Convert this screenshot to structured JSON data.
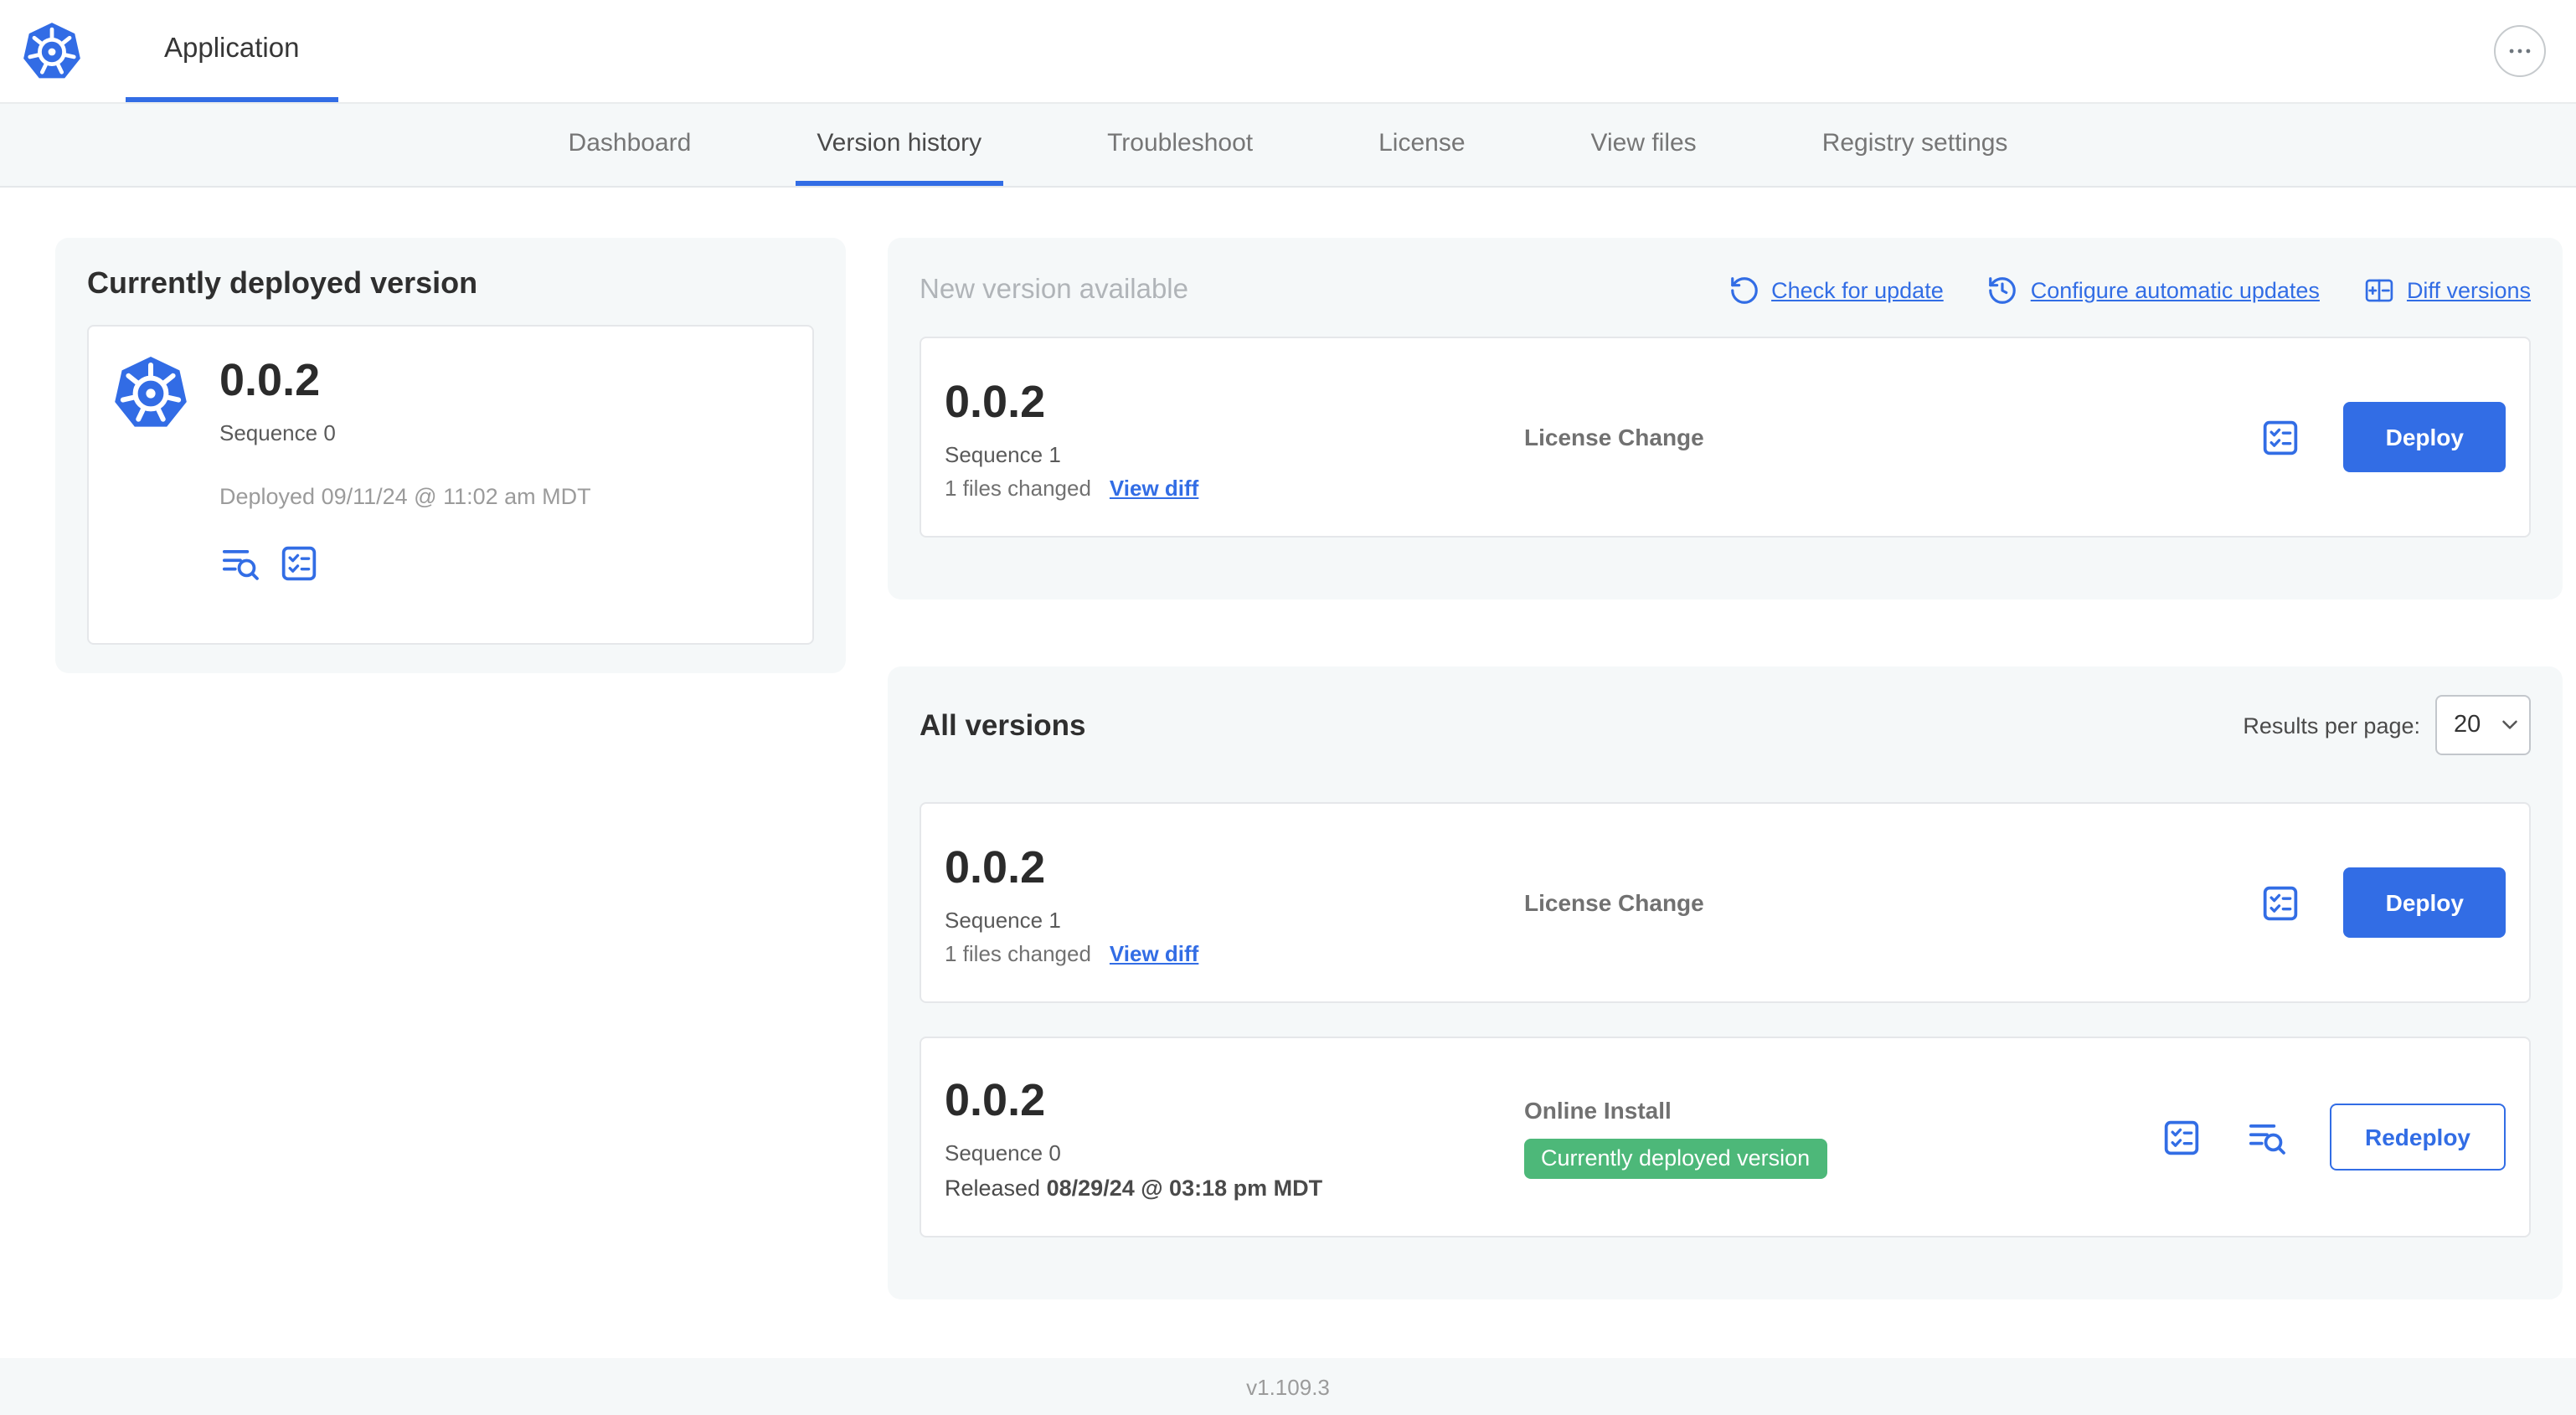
{
  "colors": {
    "accent_blue": "#326DE5",
    "badge_green": "#4DB879",
    "panel_bg": "#F5F8F9"
  },
  "header": {
    "app_tab_label": "Application"
  },
  "nav_tabs": [
    {
      "label": "Dashboard",
      "active": false
    },
    {
      "label": "Version history",
      "active": true
    },
    {
      "label": "Troubleshoot",
      "active": false
    },
    {
      "label": "License",
      "active": false
    },
    {
      "label": "View files",
      "active": false
    },
    {
      "label": "Registry settings",
      "active": false
    }
  ],
  "currently_deployed": {
    "title": "Currently deployed version",
    "version": "0.0.2",
    "sequence": "Sequence 0",
    "deployed_at": "Deployed 09/11/24 @ 11:02 am MDT"
  },
  "new_version": {
    "title": "New version available",
    "check_for_update": "Check for update",
    "configure_updates": "Configure automatic updates",
    "diff_versions": "Diff versions",
    "row": {
      "version": "0.0.2",
      "sequence": "Sequence 1",
      "files_changed": "1 files changed",
      "view_diff": "View diff",
      "source": "License Change",
      "action": "Deploy"
    }
  },
  "all_versions": {
    "title": "All versions",
    "results_per_page_label": "Results per page:",
    "results_per_page": "20",
    "rows": [
      {
        "version": "0.0.2",
        "sequence": "Sequence 1",
        "files_changed": "1 files changed",
        "view_diff": "View diff",
        "source": "License Change",
        "action": "Deploy"
      },
      {
        "version": "0.0.2",
        "sequence": "Sequence 0",
        "released_prefix": "Released",
        "released_date": "08/29/24 @ 03:18 pm MDT",
        "source": "Online Install",
        "badge": "Currently deployed version",
        "action": "Redeploy"
      }
    ]
  },
  "footer": {
    "version": "v1.109.3"
  }
}
